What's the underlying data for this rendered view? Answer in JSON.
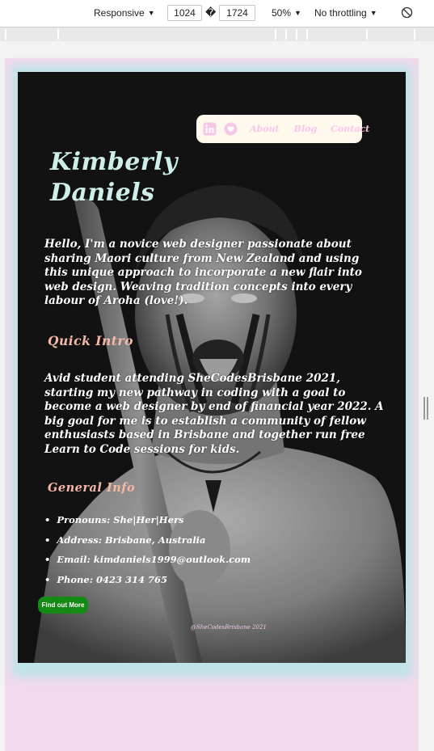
{
  "devtools": {
    "device": "Responsive",
    "width": "1024",
    "separator": "�",
    "height": "1724",
    "zoom": "50%",
    "throttle": "No throttling"
  },
  "nav": {
    "icons": [
      "linkedin-icon",
      "heart-icon"
    ],
    "links": [
      "About",
      "Blog",
      "Contact"
    ]
  },
  "hero": {
    "name_line1": "Kimberly",
    "name_line2": "Daniels",
    "intro": "Hello, I'm a novice web designer passionate about sharing Maori culture from New Zealand and using this unique approach to incorporate a new flair into web design. Weaving tradition concepts into every labour of Aroha (love!).",
    "quick_heading": "Quick Intro",
    "quick_text": "Avid student attending SheCodesBrisbane 2021, starting my new pathway in coding with a goal to become a web designer by end of financial year 2022. A big goal for me is to establish a community of fellow enthusiasts based in Brisbane and together run free Learn to Code sessions for kids.",
    "general_heading": "General Info",
    "info": [
      "Pronouns: She|Her|Hers",
      "Address: Brisbane, Australia",
      "Email: kimdaniels1999@outlook.com",
      "Phone: 0423 314 765"
    ],
    "button": "Find out More",
    "footer": "@SheCodesBrisbane 2021"
  },
  "colors": {
    "name": "#cdeeea",
    "heading": "#f6b8a6",
    "nav_bg": "#fff8ec",
    "nav_text": "#f7c7e8",
    "button": "#138a14",
    "page_bg": "#f3d9ee"
  }
}
